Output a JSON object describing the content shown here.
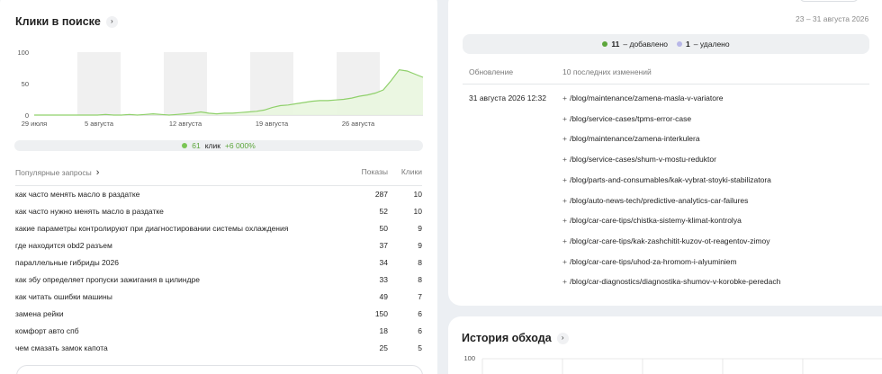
{
  "left_card": {
    "title": "Клики в поиске",
    "chevron": "›",
    "chart": {
      "y_ticks": [
        "100",
        "50",
        "0"
      ],
      "x_ticks": [
        "29 июля",
        "5 августа",
        "12 августа",
        "19 августа",
        "26 августа"
      ]
    },
    "legend": {
      "value": "61",
      "label": "клик",
      "delta": "+6 000%",
      "color": "#7bc555"
    },
    "queries": {
      "header_title": "Популярные запросы",
      "header_chevron": "›",
      "col_shows": "Показы",
      "col_clicks": "Клики",
      "rows": [
        {
          "q": "как часто менять масло в раздатке",
          "shows": "287",
          "clicks": "10"
        },
        {
          "q": "как часто нужно менять масло в раздатке",
          "shows": "52",
          "clicks": "10"
        },
        {
          "q": "какие параметры контролируют при диагностировании системы охлаждения",
          "shows": "50",
          "clicks": "9"
        },
        {
          "q": "где находится obd2 разъем",
          "shows": "37",
          "clicks": "9"
        },
        {
          "q": "параллельные гибриды 2026",
          "shows": "34",
          "clicks": "8"
        },
        {
          "q": "как эбу определяет пропуски зажигания в цилиндре",
          "shows": "33",
          "clicks": "8"
        },
        {
          "q": "как читать ошибки машины",
          "shows": "49",
          "clicks": "7"
        },
        {
          "q": "замена рейки",
          "shows": "150",
          "clicks": "6"
        },
        {
          "q": "комфорт авто спб",
          "shows": "18",
          "clicks": "6"
        },
        {
          "q": "чем смазать замок капота",
          "shows": "25",
          "clicks": "5"
        }
      ]
    }
  },
  "chart_data": {
    "type": "area",
    "title": "Клики в поиске",
    "ylim": [
      0,
      100
    ],
    "y_ticks": [
      0,
      50,
      100
    ],
    "x_tick_labels": [
      "29 июля",
      "5 августа",
      "12 августа",
      "19 августа",
      "26 августа"
    ],
    "series": [
      {
        "values": [
          0,
          0,
          0,
          0,
          0,
          0,
          0,
          0,
          0,
          1,
          0,
          0,
          1,
          0,
          1,
          2,
          1,
          0,
          1,
          2,
          3,
          5,
          3,
          2,
          3,
          3,
          4,
          5,
          6,
          8,
          12,
          15,
          16,
          18,
          20,
          22,
          23,
          23,
          24,
          25,
          27,
          30,
          32,
          35,
          40,
          55,
          72,
          70,
          65,
          60
        ],
        "color": "#8fd06b"
      }
    ],
    "grid": true
  },
  "right_card": {
    "date_range": "23 – 31 августа 2026",
    "summary": {
      "added_count": "11",
      "added_label": "– добавлено",
      "removed_count": "1",
      "removed_label": "– удалено",
      "added_color": "#5ca63b",
      "removed_color": "#b8b7e8"
    },
    "col_update": "Обновление",
    "col_changes": "10 последних изменений",
    "update_date": "31 августа 2026 12:32",
    "changes": [
      {
        "sign": "+",
        "path": "/blog/maintenance/zamena-masla-v-variatore"
      },
      {
        "sign": "+",
        "path": "/blog/service-cases/tpms-error-case"
      },
      {
        "sign": "+",
        "path": "/blog/maintenance/zamena-interkulera"
      },
      {
        "sign": "+",
        "path": "/blog/service-cases/shum-v-mostu-reduktor"
      },
      {
        "sign": "+",
        "path": "/blog/parts-and-consumables/kak-vybrat-stoyki-stabilizatora"
      },
      {
        "sign": "+",
        "path": "/blog/auto-news-tech/predictive-analytics-car-failures"
      },
      {
        "sign": "+",
        "path": "/blog/car-care-tips/chistka-sistemy-klimat-kontrolya"
      },
      {
        "sign": "+",
        "path": "/blog/car-care-tips/kak-zashchitit-kuzov-ot-reagentov-zimoy"
      },
      {
        "sign": "+",
        "path": "/blog/car-care-tips/uhod-za-hromom-i-alyuminiem"
      },
      {
        "sign": "+",
        "path": "/blog/car-diagnostics/diagnostika-shumov-v-korobke-peredach"
      }
    ]
  },
  "history_card": {
    "title": "История обхода",
    "chevron": "›",
    "y_top": "100"
  }
}
